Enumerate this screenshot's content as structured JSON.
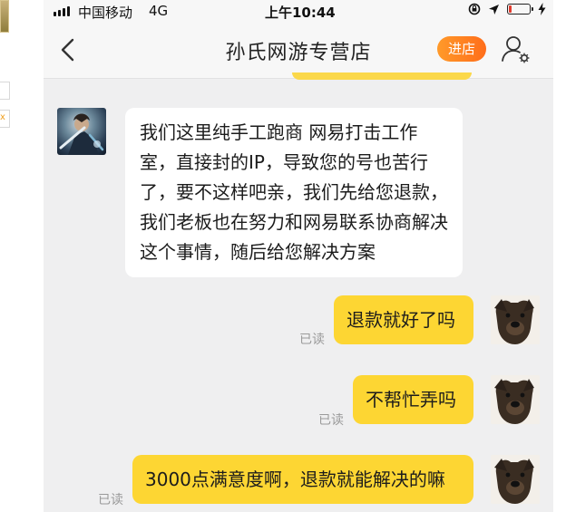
{
  "status_bar": {
    "carrier": "中国移动",
    "network": "4G",
    "time": "上午10:44",
    "battery_level": 0.15,
    "battery_color": "#e23b2e"
  },
  "nav": {
    "title": "孙氏网游专营店",
    "enter_shop_label": "进店",
    "accent_color": "#ff7a1e"
  },
  "left_page": {
    "tag": "x"
  },
  "messages": [
    {
      "side": "left",
      "text": "我们这里纯手工跑商  网易打击工作室，直接封的IP，导致您的号也苦行了，要不这样吧亲，我们先给您退款，我们老板也在努力和网易联系协商解决这个事情，随后给您解决方案"
    },
    {
      "side": "right",
      "text": "退款就好了吗",
      "status": "已读"
    },
    {
      "side": "right",
      "text": "不帮忙弄吗",
      "status": "已读"
    },
    {
      "side": "right",
      "text": "3000点满意度啊，退款就能解决的嘛",
      "status": "已读"
    }
  ],
  "colors": {
    "bubble_self": "#fdd633",
    "bubble_other": "#ffffff",
    "chat_background": "#efeff0"
  }
}
